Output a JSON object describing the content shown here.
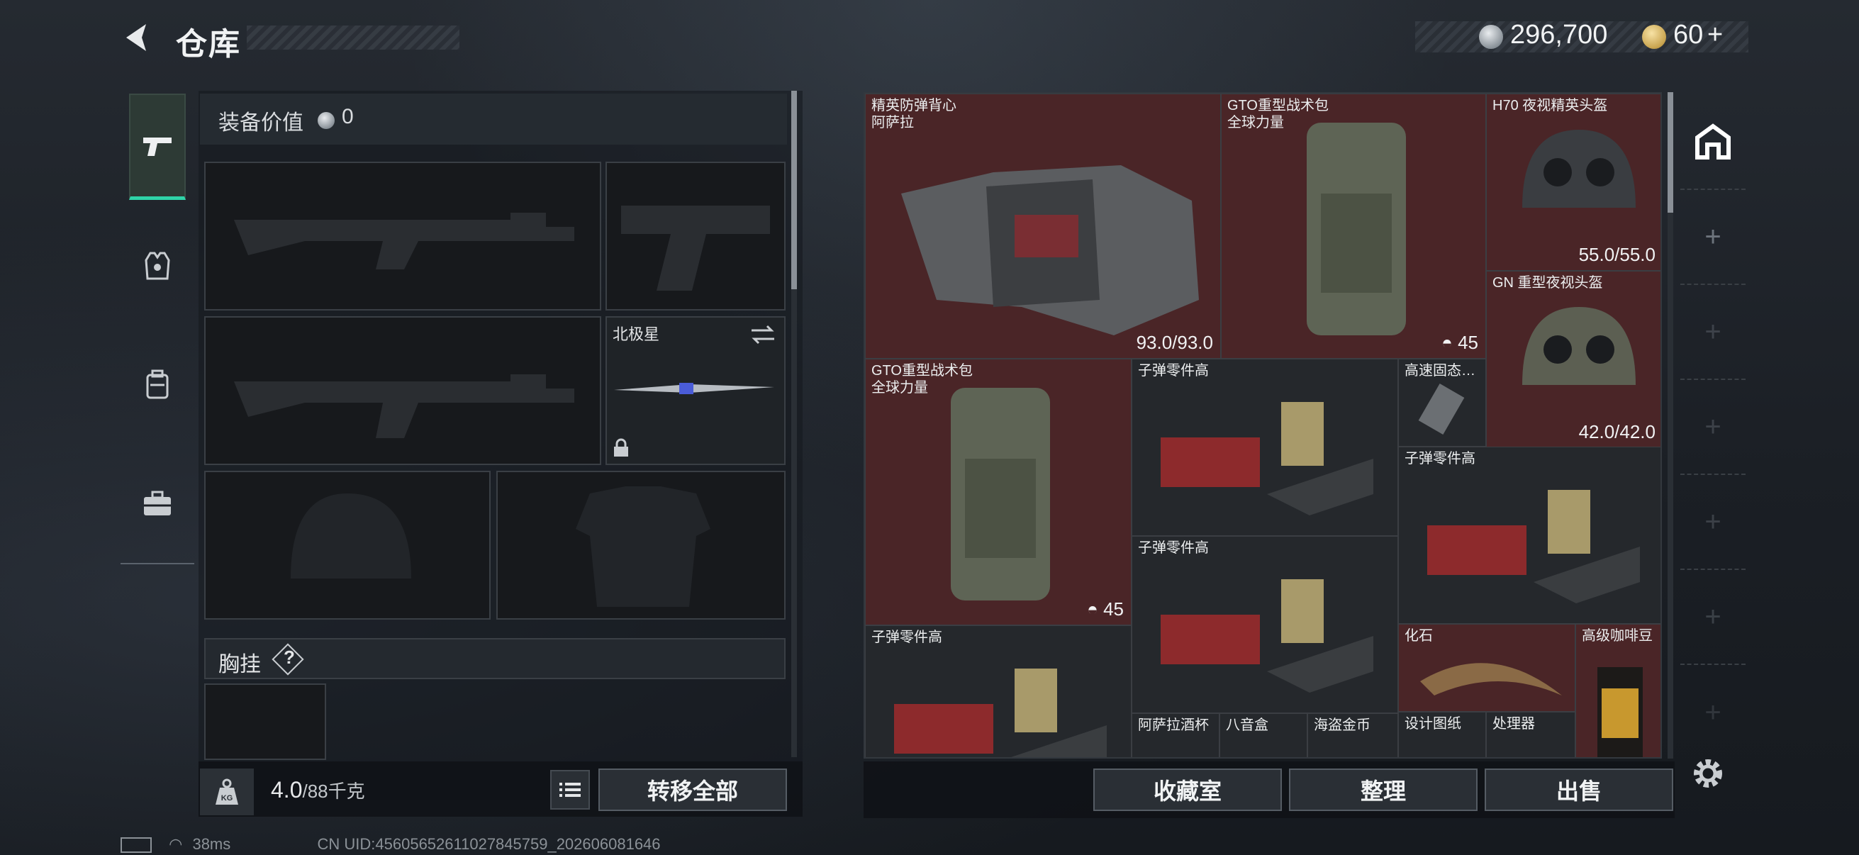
{
  "header": {
    "title": "仓库",
    "silver_amount": "296,700",
    "gold_amount": "60",
    "gold_plus": "+"
  },
  "nav": {
    "items": [
      "weapons",
      "helmet-armor",
      "backpack",
      "case"
    ]
  },
  "equipment": {
    "value_label": "装备价值",
    "value": "0",
    "melee_name": "北极星",
    "chest_label": "胸挂",
    "help": "?",
    "weight_value": "4.0",
    "weight_max": "/88千克",
    "kg_label": "KG",
    "transfer_all": "转移全部"
  },
  "stash": {
    "items": [
      {
        "name": "精英防弹背心\n阿萨拉",
        "value": "93.0/93.0",
        "color": "#4a2527"
      },
      {
        "name": "GTO重型战术包\n全球力量",
        "value": "45",
        "color": "#4a2527"
      },
      {
        "name": "H70 夜视精英头盔",
        "value": "55.0/55.0",
        "color": "#4a2527"
      },
      {
        "name": "GN 重型夜视头盔",
        "value": "42.0/42.0",
        "color": "#4a2527"
      },
      {
        "name": "GTO重型战术包\n全球力量",
        "value": "45",
        "color": "#4a2527"
      },
      {
        "name": "子弹零件高",
        "value": "",
        "color": "#25282c"
      },
      {
        "name": "高速固态…",
        "value": "",
        "color": "#25282c"
      },
      {
        "name": "子弹零件高",
        "value": "",
        "color": "#25282c"
      },
      {
        "name": "子弹零件高",
        "value": "",
        "color": "#25282c"
      },
      {
        "name": "子弹零件高",
        "value": "",
        "color": "#25282c"
      },
      {
        "name": "化石",
        "value": "",
        "color": "#4a2527"
      },
      {
        "name": "高级咖啡豆",
        "value": "",
        "color": "#4a2527"
      },
      {
        "name": "阿萨拉酒杯",
        "value": "",
        "color": "#25282c"
      },
      {
        "name": "八音盒",
        "value": "",
        "color": "#25282c"
      },
      {
        "name": "海盗金币",
        "value": "",
        "color": "#25282c"
      },
      {
        "name": "设计图纸",
        "value": "",
        "color": "#25282c"
      },
      {
        "name": "处理器",
        "value": "",
        "color": "#25282c"
      }
    ],
    "collection": "收藏室",
    "sort": "整理",
    "sell": "出售"
  },
  "status": {
    "ping": "38ms",
    "uid": "CN UID:4560565261102784575​9_202606081646"
  }
}
